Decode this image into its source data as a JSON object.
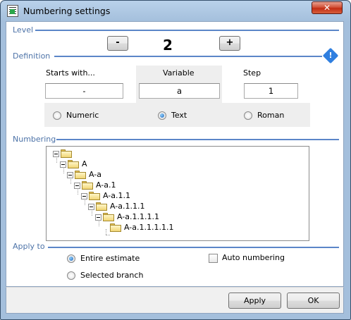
{
  "window": {
    "title": "Numbering settings",
    "close_glyph": "✕"
  },
  "sections": {
    "level": "Level",
    "definition": "Definition",
    "numbering": "Numbering",
    "apply_to": "Apply to"
  },
  "level": {
    "minus_label": "-",
    "value": "2",
    "plus_label": "+"
  },
  "definition": {
    "info_glyph": "!",
    "columns": [
      {
        "label": "Starts with...",
        "value": "-"
      },
      {
        "label": "Variable",
        "value": "a"
      },
      {
        "label": "Step",
        "value": "1"
      }
    ],
    "types": [
      {
        "label": "Numeric",
        "selected": false
      },
      {
        "label": "Text",
        "selected": true
      },
      {
        "label": "Roman",
        "selected": false
      }
    ]
  },
  "tree": {
    "nodes": [
      {
        "label": ""
      },
      {
        "label": "A"
      },
      {
        "label": "A-a"
      },
      {
        "label": "A-a.1"
      },
      {
        "label": "A-a.1.1"
      },
      {
        "label": "A-a.1.1.1"
      },
      {
        "label": "A-a.1.1.1.1"
      },
      {
        "label": "A-a.1.1.1.1.1"
      }
    ]
  },
  "apply_to": {
    "options": [
      {
        "label": "Entire estimate",
        "selected": true
      },
      {
        "label": "Selected branch",
        "selected": false
      }
    ],
    "auto_numbering": {
      "label": "Auto numbering",
      "checked": false
    }
  },
  "footer": {
    "apply_label": "Apply",
    "ok_label": "OK"
  },
  "colors": {
    "section_label": "#4d73a8",
    "section_line": "#5b86c8",
    "radio_selected": "#1f63b5"
  }
}
